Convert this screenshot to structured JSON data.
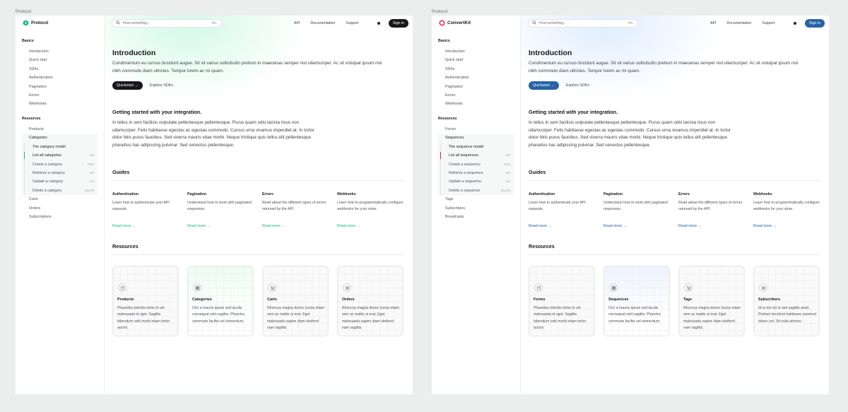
{
  "frames": [
    {
      "label": "Protocol",
      "brand": "Protocol",
      "accent": "#10b981",
      "dark_button": "#18181b",
      "sidebar": {
        "basics_heading": "Basics",
        "basics": [
          "Introduction",
          "Quick start",
          "SDKs",
          "Authentication",
          "Pagination",
          "Errors",
          "Webhooks"
        ],
        "resources_heading": "Resources",
        "resources_top": [
          "Products",
          "Categories"
        ],
        "group": [
          {
            "label": "The category model",
            "method": "",
            "active": false
          },
          {
            "label": "List all categories",
            "method": "GET",
            "active": true
          },
          {
            "label": "Create a category",
            "method": "POST",
            "active": false
          },
          {
            "label": "Retrieve a category",
            "method": "GET",
            "active": false
          },
          {
            "label": "Update a category",
            "method": "PUT",
            "active": false
          },
          {
            "label": "Delete a category",
            "method": "DELETE",
            "active": false
          }
        ],
        "resources_bottom": [
          "Carts",
          "Orders",
          "Subscriptions"
        ]
      },
      "topbar": {
        "search_placeholder": "Find something...",
        "shortcut": "⌘K",
        "links": [
          "API",
          "Documentation",
          "Support"
        ],
        "signin": "Sign in"
      },
      "intro": {
        "title": "Introduction",
        "lead": "Condimentum eu cursus tincidunt augue. Sit sit varius sollicitudin pretium in maecenas semper nisl ullamcorper. Ac sit volutpat ipsum nisl nibh commodo diam ultricies. Tempor lorem ac mi quam.",
        "primary": "Quickstart →",
        "secondary": "Explore SDKs"
      },
      "getting_started": {
        "title": "Getting started with your integration.",
        "body": "In tellus in sem facilisis vulputate pellentesque pellentesque. Purus quam odio lacinia risus non ullamcorper. Felis habitasse egestas ac egestas commodo. Cursus urna vivamus imperdiet at. In tortor dolor felis purus faucibus. Sed viverra mauris vitae morbi. Neque tristique quis tellus elit pellentesque phasellus hac adipiscing pulvinar. Sed senectus pellentesque."
      },
      "guides": {
        "title": "Guides",
        "items": [
          {
            "title": "Authentication",
            "desc": "Learn how to authenticate your API requests.",
            "link": "Read more →"
          },
          {
            "title": "Pagination",
            "desc": "Understand how to work with paginated responses.",
            "link": "Read more →"
          },
          {
            "title": "Errors",
            "desc": "Read about the different types of errors returned by the API.",
            "link": "Read more →"
          },
          {
            "title": "Webhooks",
            "desc": "Learn how to programmatically configure webhooks for your store.",
            "link": "Read more →"
          }
        ]
      },
      "resources": {
        "title": "Resources",
        "items": [
          {
            "title": "Products",
            "desc": "Phasellus lobortis tortor in vel malesuada id eget. Sagittis bibendum velit morbi etiam tortor auctor.",
            "icon": "box-icon"
          },
          {
            "title": "Categories",
            "desc": "Orci a mauris ipsum sed iaculis consequat velit sagittis. Pharetra commodo facilisi vel elementum.",
            "icon": "grid-icon"
          },
          {
            "title": "Carts",
            "desc": "Rhoncus magna donec luctus etiam sem ac mattis ut erat. Eget malesuada sapien diam eleifend nam sagittis.",
            "icon": "cart-icon"
          },
          {
            "title": "Orders",
            "desc": "Rhoncus magna donec luctus etiam sem ac mattis ut erat. Eget malesuada sapien diam eleifend nam sagittis.",
            "icon": "globe-icon"
          }
        ]
      }
    },
    {
      "label": "Protocol",
      "brand": "ConvertKit",
      "accent": "#e11d48",
      "dark_button": "#2563a6",
      "sidebar": {
        "basics_heading": "Basics",
        "basics": [
          "Introduction",
          "Quick start",
          "SDKs",
          "Authentication",
          "Pagination",
          "Errors",
          "Webhooks"
        ],
        "resources_heading": "Resources",
        "resources_top": [
          "Forms",
          "Sequences"
        ],
        "group": [
          {
            "label": "The sequence model",
            "method": "",
            "active": false
          },
          {
            "label": "List all sequences",
            "method": "GET",
            "active": true
          },
          {
            "label": "Create a sequence",
            "method": "POST",
            "active": false
          },
          {
            "label": "Retrieve a sequence",
            "method": "GET",
            "active": false
          },
          {
            "label": "Update a sequence",
            "method": "PUT",
            "active": false
          },
          {
            "label": "Delete a sequence",
            "method": "DELETE",
            "active": false
          }
        ],
        "resources_bottom": [
          "Tags",
          "Subscribers",
          "Broadcasts"
        ]
      },
      "topbar": {
        "search_placeholder": "Find something...",
        "shortcut": "⌘K",
        "links": [
          "API",
          "Documentation",
          "Support"
        ],
        "signin": "Sign in"
      },
      "intro": {
        "title": "Introduction",
        "lead": "Condimentum eu cursus tincidunt augue. Sit sit varius sollicitudin pretium in maecenas semper nisl ullamcorper. Ac sit volutpat ipsum nisl nibh commodo diam ultricies. Tempor lorem ac mi quam.",
        "primary": "Quickstart →",
        "secondary": "Explore SDKs"
      },
      "getting_started": {
        "title": "Getting started with your integration.",
        "body": "In tellus in sem facilisis vulputate pellentesque pellentesque. Purus quam odio lacinia risus non ullamcorper. Felis habitasse egestas ac egestas commodo. Cursus urna vivamus imperdiet at. In tortor dolor felis purus faucibus. Sed viverra mauris vitae morbi. Neque tristique quis tellus elit pellentesque phasellus hac adipiscing pulvinar. Sed senectus pellentesque."
      },
      "guides": {
        "title": "Guides",
        "items": [
          {
            "title": "Authentication",
            "desc": "Learn how to authenticate your API requests.",
            "link": "Read more →"
          },
          {
            "title": "Pagination",
            "desc": "Understand how to work with paginated responses.",
            "link": "Read more →"
          },
          {
            "title": "Errors",
            "desc": "Read about the different types of errors returned by the API.",
            "link": "Read more →"
          },
          {
            "title": "Webhooks",
            "desc": "Learn how to programmatically configure webhooks for your store.",
            "link": "Read more →"
          }
        ]
      },
      "resources": {
        "title": "Resources",
        "items": [
          {
            "title": "Forms",
            "desc": "Phasellus lobortis tortor in vel malesuada id eget. Sagittis bibendum velit morbi etiam tortor auctor.",
            "icon": "box-icon"
          },
          {
            "title": "Sequences",
            "desc": "Orci a mauris ipsum sed iaculis consequat velit sagittis. Pharetra commodo facilisi vel elementum.",
            "icon": "grid-icon"
          },
          {
            "title": "Tags",
            "desc": "Rhoncus magna donec luctus etiam sem ac mattis ut erat. Eget malesuada sapien diam eleifend nam sagittis.",
            "icon": "cart-icon"
          },
          {
            "title": "Subscribers",
            "desc": "Id ut est vel ut sed sagittis amet. Pretium tincidunt habitasse euismod donec est. Sit nulla ultrices.",
            "icon": "globe-icon"
          }
        ]
      }
    }
  ]
}
